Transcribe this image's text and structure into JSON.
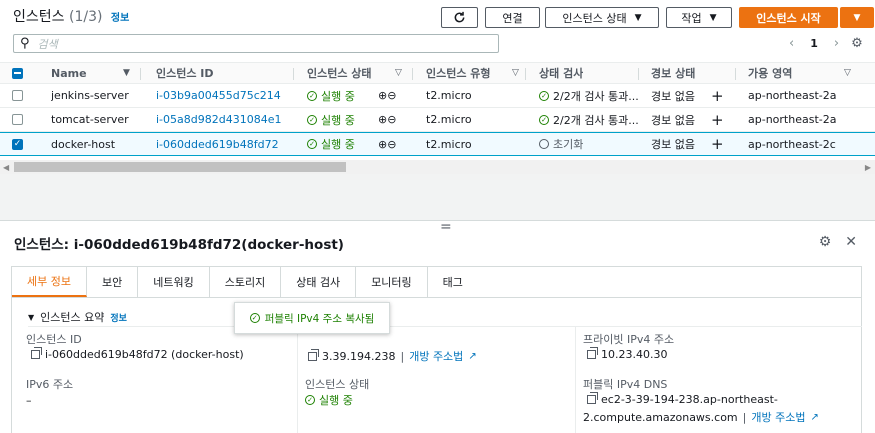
{
  "header": {
    "title": "인스턴스",
    "count": "(1/3)",
    "info": "정보",
    "refresh_icon": "refresh-icon",
    "connect_label": "연결",
    "state_label": "인스턴스 상태",
    "actions_label": "작업",
    "launch_label": "인스턴스 시작"
  },
  "search": {
    "placeholder": "검색"
  },
  "pager": {
    "page": "1"
  },
  "table": {
    "columns": [
      "Name",
      "인스턴스 ID",
      "인스턴스 상태",
      "인스턴스 유형",
      "상태 검사",
      "경보 상태",
      "가용 영역"
    ],
    "rows": [
      {
        "name": "jenkins-server",
        "id": "i-03b9a00455d75c214",
        "state": "실행 중",
        "type": "t2.micro",
        "check": "2/2개 검사 통과...",
        "alarm": "경보 없음",
        "az": "ap-northeast-2a",
        "selected": false
      },
      {
        "name": "tomcat-server",
        "id": "i-05a8d982d431084e1",
        "state": "실행 중",
        "type": "t2.micro",
        "check": "2/2개 검사 통과...",
        "alarm": "경보 없음",
        "az": "ap-northeast-2a",
        "selected": false
      },
      {
        "name": "docker-host",
        "id": "i-060dded619b48fd72",
        "state": "실행 중",
        "type": "t2.micro",
        "check": "초기화",
        "alarm": "경보 없음",
        "az": "ap-northeast-2c",
        "selected": true
      }
    ]
  },
  "detail": {
    "title": "인스턴스: i-060dded619b48fd72(docker-host)",
    "tabs": [
      "세부 정보",
      "보안",
      "네트워킹",
      "스토리지",
      "상태 검사",
      "모니터링",
      "태그"
    ],
    "active_tab": "세부 정보",
    "summary_label": "인스턴스 요약",
    "summary_info": "정보",
    "fields": {
      "instance_id_label": "인스턴스 ID",
      "instance_id_value": "i-060dded619b48fd72 (docker-host)",
      "public_ip_value": "3.39.194.238",
      "open_address": "개방 주소법",
      "private_ip_label": "프라이빗 IPv4 주소",
      "private_ip_value": "10.23.40.30",
      "ipv6_label": "IPv6 주소",
      "ipv6_value": "–",
      "state_label": "인스턴스 상태",
      "state_value": "실행 중",
      "public_dns_label": "퍼블릭 IPv4 DNS",
      "public_dns_line1": "ec2-3-39-194-238.ap-northeast-",
      "public_dns_line2": "2.compute.amazonaws.com",
      "public_dns_open": "개방 주소법"
    },
    "toast": "퍼블릭 IPv4 주소 복사됨"
  },
  "colors": {
    "accent": "#ec7211",
    "link": "#0073bb",
    "ok": "#1d8102"
  }
}
